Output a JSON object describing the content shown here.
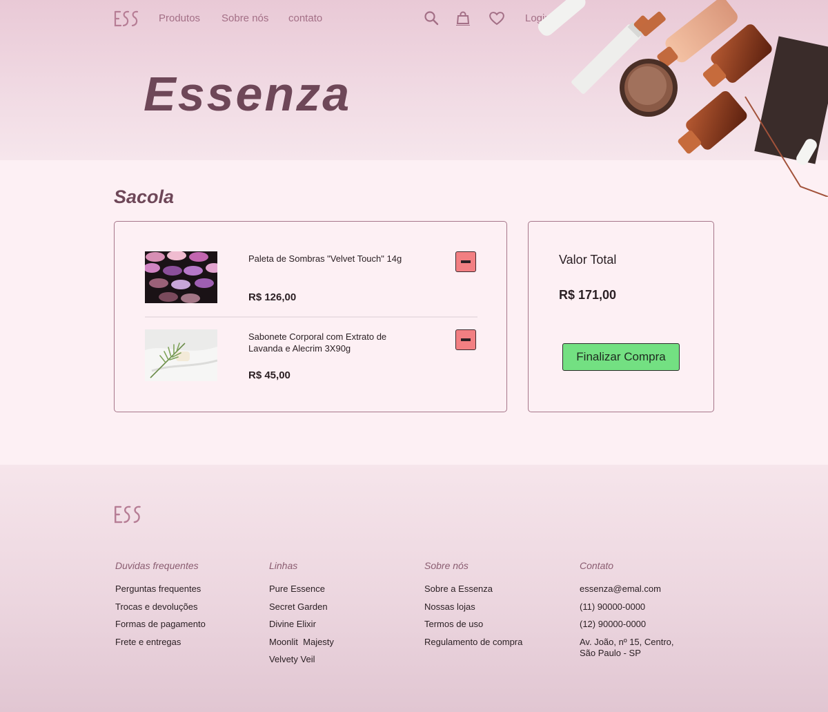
{
  "brand": {
    "logo_text": "ESS",
    "hero_title": "Essenza"
  },
  "nav": {
    "links": [
      "Produtos",
      "Sobre nós",
      "contato"
    ],
    "login": "Login",
    "icons": [
      "search-icon",
      "shopping-bag-icon",
      "heart-icon"
    ]
  },
  "cart": {
    "title": "Sacola",
    "items": [
      {
        "name": "Paleta de Sombras \"Velvet Touch\" 14g",
        "price": "R$ 126,00"
      },
      {
        "name": "Sabonete Corporal com Extrato de Lavanda e Alecrim 3X90g",
        "price": "R$ 45,00"
      }
    ]
  },
  "summary": {
    "label": "Valor Total",
    "value": "R$ 171,00",
    "checkout": "Finalizar Compra"
  },
  "footer": {
    "columns": [
      {
        "title": "Duvidas frequentes",
        "items": [
          "Perguntas frequentes",
          "Trocas e devoluções",
          "Formas de pagamento",
          "Frete e entregas"
        ]
      },
      {
        "title": "Linhas",
        "items": [
          "Pure Essence",
          "Secret Garden",
          "Divine Elixir",
          "Moonlit  Majesty",
          "Velvety Veil"
        ]
      },
      {
        "title": "Sobre nós",
        "items": [
          "Sobre a Essenza",
          "Nossas lojas",
          "Termos de uso",
          "Regulamento de compra"
        ]
      },
      {
        "title": "Contato",
        "items": [
          "essenza@emal.com",
          "(11) 90000-0000",
          "(12) 90000-0000",
          "Av. João, nº 15, Centro, São Paulo - SP"
        ]
      }
    ]
  },
  "colors": {
    "accent": "#a36f86",
    "title": "#6e4758",
    "remove": "#f27f82",
    "checkout": "#73e082"
  }
}
